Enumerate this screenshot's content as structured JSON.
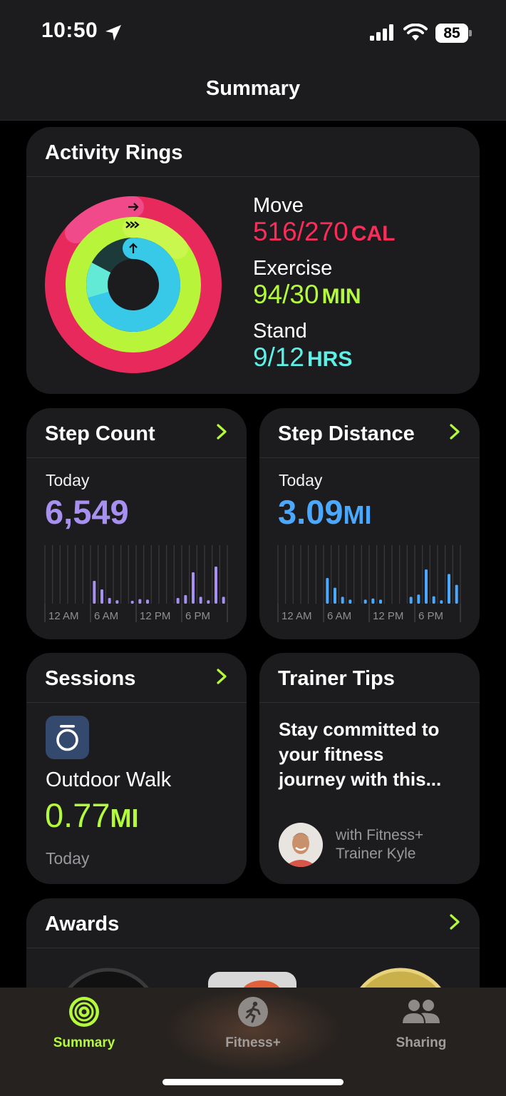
{
  "status": {
    "time": "10:50",
    "battery": "85"
  },
  "nav": {
    "title": "Summary"
  },
  "activity": {
    "title": "Activity Rings",
    "move": {
      "label": "Move",
      "value": "516/270",
      "unit": "CAL",
      "color": "#fa2d5a"
    },
    "exercise": {
      "label": "Exercise",
      "value": "94/30",
      "unit": "MIN",
      "color": "#b4fa3c"
    },
    "stand": {
      "label": "Stand",
      "value": "9/12",
      "unit": "HRS",
      "color": "#5ef0e6"
    }
  },
  "step_count": {
    "title": "Step Count",
    "period": "Today",
    "value": "6,549",
    "color": "#a890f0",
    "axis": [
      "12 AM",
      "6 AM",
      "12 PM",
      "6 PM"
    ],
    "hourly": [
      0,
      0,
      0,
      0,
      0,
      0,
      0.4,
      0.25,
      0.1,
      0.06,
      0,
      0.05,
      0.08,
      0.07,
      0,
      0,
      0,
      0.1,
      0.15,
      0.55,
      0.12,
      0.06,
      0.65,
      0.12
    ]
  },
  "step_distance": {
    "title": "Step Distance",
    "period": "Today",
    "value": "3.09",
    "unit": "MI",
    "color": "#4aa8ff",
    "axis": [
      "12 AM",
      "6 AM",
      "12 PM",
      "6 PM"
    ],
    "hourly": [
      0,
      0,
      0,
      0,
      0,
      0,
      0.45,
      0.28,
      0.12,
      0.07,
      0,
      0.07,
      0.09,
      0.07,
      0,
      0,
      0,
      0.12,
      0.16,
      0.6,
      0.13,
      0.06,
      0.52,
      0.33
    ]
  },
  "sessions": {
    "title": "Sessions",
    "activity": "Outdoor Walk",
    "value": "0.77",
    "unit": "MI",
    "period": "Today",
    "color": "#b4fa3c"
  },
  "trainer_tips": {
    "title": "Trainer Tips",
    "text": "Stay committed to your fitness journey with this...",
    "line1": "Stay committed to",
    "line2": "your fitness",
    "line3": "journey with this...",
    "credit1": "with Fitness+",
    "credit2": "Trainer Kyle"
  },
  "awards": {
    "title": "Awards"
  },
  "tabs": [
    {
      "label": "Summary",
      "icon": "activity-rings-icon",
      "active": true
    },
    {
      "label": "Fitness+",
      "icon": "running-figure-icon",
      "active": false
    },
    {
      "label": "Sharing",
      "icon": "people-icon",
      "active": false
    }
  ],
  "colors": {
    "accent": "#b4fa3c",
    "card": "#1c1c1e",
    "background": "#000000"
  }
}
